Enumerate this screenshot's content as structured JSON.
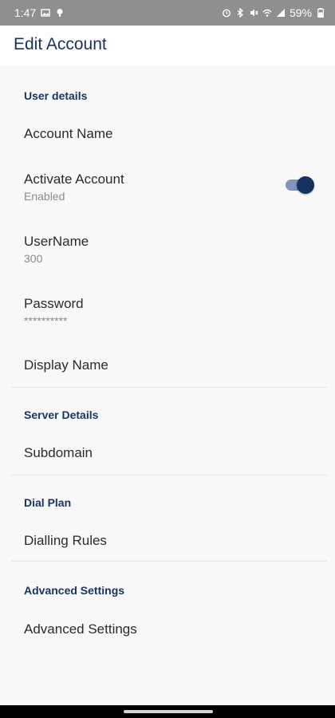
{
  "status_bar": {
    "time": "1:47",
    "battery": "59%",
    "icons_left": [
      "gallery-icon",
      "location-icon"
    ],
    "icons_right": [
      "alarm-icon",
      "bluetooth-icon",
      "mute-icon",
      "wifi-icon",
      "signal-icon",
      "battery-icon"
    ]
  },
  "app_bar": {
    "title": "Edit Account"
  },
  "sections": {
    "user_details": {
      "header": "User details",
      "account_name": "Account Name",
      "activate_account": {
        "title": "Activate Account",
        "subtitle": "Enabled",
        "enabled": true
      },
      "username": {
        "title": "UserName",
        "value": "300"
      },
      "password": {
        "title": "Password",
        "value": "**********"
      },
      "display_name": "Display Name"
    },
    "server_details": {
      "header": "Server Details",
      "subdomain": "Subdomain"
    },
    "dial_plan": {
      "header": "Dial Plan",
      "dialling_rules": "Dialling Rules"
    },
    "advanced_settings": {
      "header": "Advanced Settings",
      "advanced_settings": "Advanced Settings"
    }
  },
  "colors": {
    "accent": "#17325f",
    "status_bar": "#8f8f8f",
    "toggle_track": "#7f95ba",
    "background": "#f8f8f8"
  }
}
